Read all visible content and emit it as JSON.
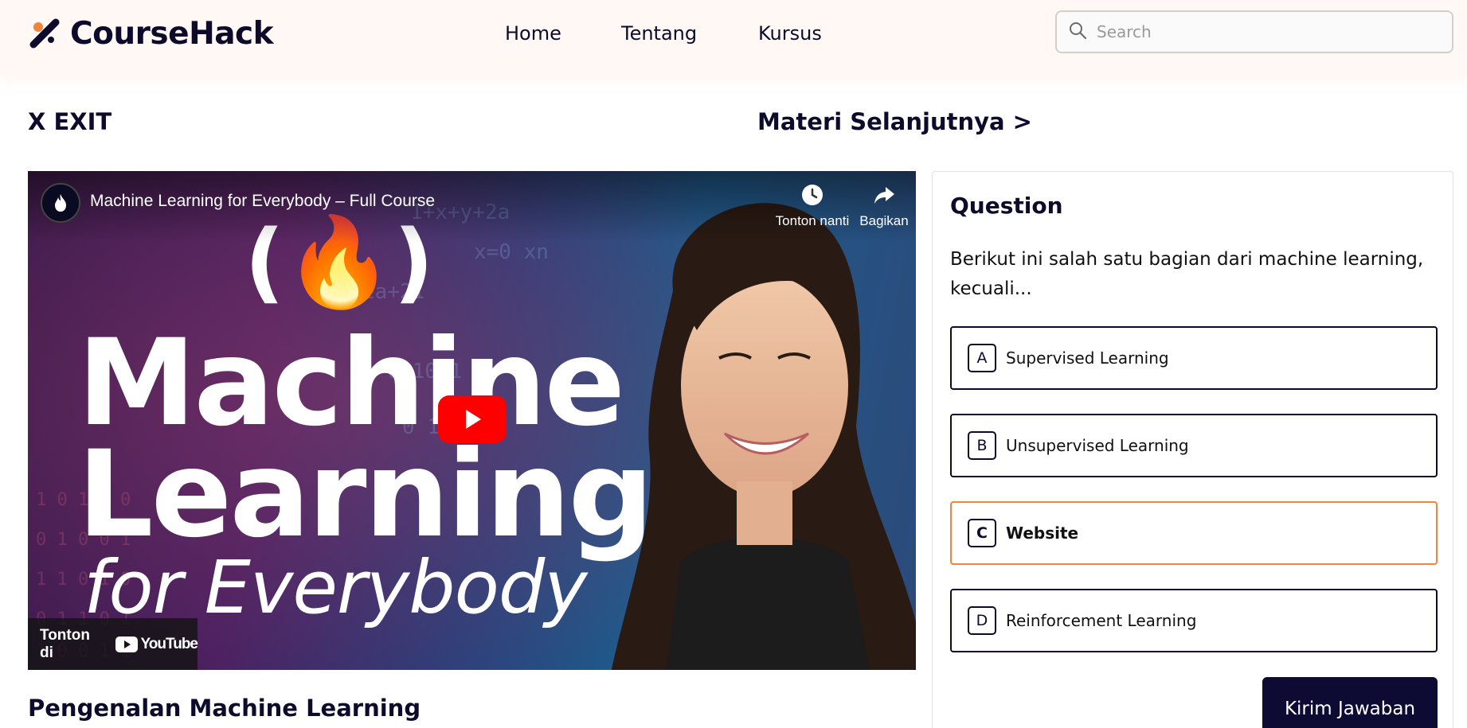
{
  "header": {
    "brand": "CourseHack",
    "nav": [
      {
        "label": "Home"
      },
      {
        "label": "Tentang"
      },
      {
        "label": "Kursus"
      }
    ],
    "search": {
      "placeholder": "Search",
      "value": ""
    }
  },
  "topbar": {
    "exit_label": "X EXIT",
    "next_label": "Materi Selanjutnya >"
  },
  "video": {
    "title": "Machine Learning for Everybody – Full Course",
    "watch_later_label": "Tonton nanti",
    "share_label": "Bagikan",
    "thumbnail_lines": [
      "Machine",
      "Learning",
      "for Everybody"
    ],
    "logo_text": "(🔥)",
    "watch_on_label": "Tonton di",
    "youtube_label": "YouTube",
    "colors": {
      "play": "#ff0000"
    }
  },
  "lesson": {
    "title": "Pengenalan Machine Learning"
  },
  "question": {
    "heading": "Question",
    "text": "Berikut ini salah satu bagian dari machine learning, kecuali...",
    "options": [
      {
        "letter": "A",
        "label": "Supervised Learning",
        "selected": false
      },
      {
        "letter": "B",
        "label": "Unsupervised Learning",
        "selected": false
      },
      {
        "letter": "C",
        "label": "Website",
        "selected": true
      },
      {
        "letter": "D",
        "label": "Reinforcement Learning",
        "selected": false
      }
    ],
    "submit_label": "Kirim Jawaban",
    "colors": {
      "selected_border": "#f0843c",
      "submit_bg": "#0d0a33"
    }
  }
}
